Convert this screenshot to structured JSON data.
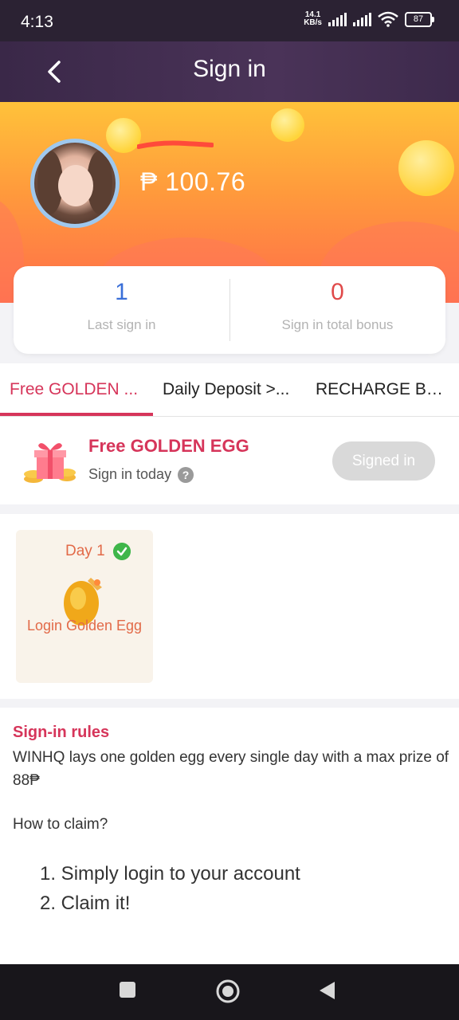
{
  "status_bar": {
    "time": "4:13",
    "net_speed_value": "14.1",
    "net_speed_unit": "KB/s",
    "battery": "87"
  },
  "header": {
    "title": "Sign in"
  },
  "profile": {
    "balance": "₱ 100.76"
  },
  "stats": {
    "last_sign_in_value": "1",
    "last_sign_in_label": "Last sign in",
    "total_bonus_value": "0",
    "total_bonus_label": "Sign in total bonus"
  },
  "tabs": [
    {
      "label": "Free GOLDEN ..."
    },
    {
      "label": "Daily Deposit >..."
    },
    {
      "label": "RECHARGE BO..."
    }
  ],
  "egg_section": {
    "title": "Free GOLDEN EGG",
    "subtitle": "Sign in today",
    "button": "Signed in"
  },
  "day_card": {
    "day": "Day 1",
    "name": "Login Golden Egg"
  },
  "rules": {
    "title": "Sign-in rules",
    "text": "WINHQ lays one golden egg every single day with a max prize of 88₱",
    "question": "How to claim?",
    "steps": [
      "1. Simply login to your account",
      "2. Claim it!"
    ]
  },
  "colors": {
    "accent": "#d6355a",
    "header_bg": "#3a2848",
    "day_text": "#e26a48",
    "check": "#3fb64a"
  }
}
